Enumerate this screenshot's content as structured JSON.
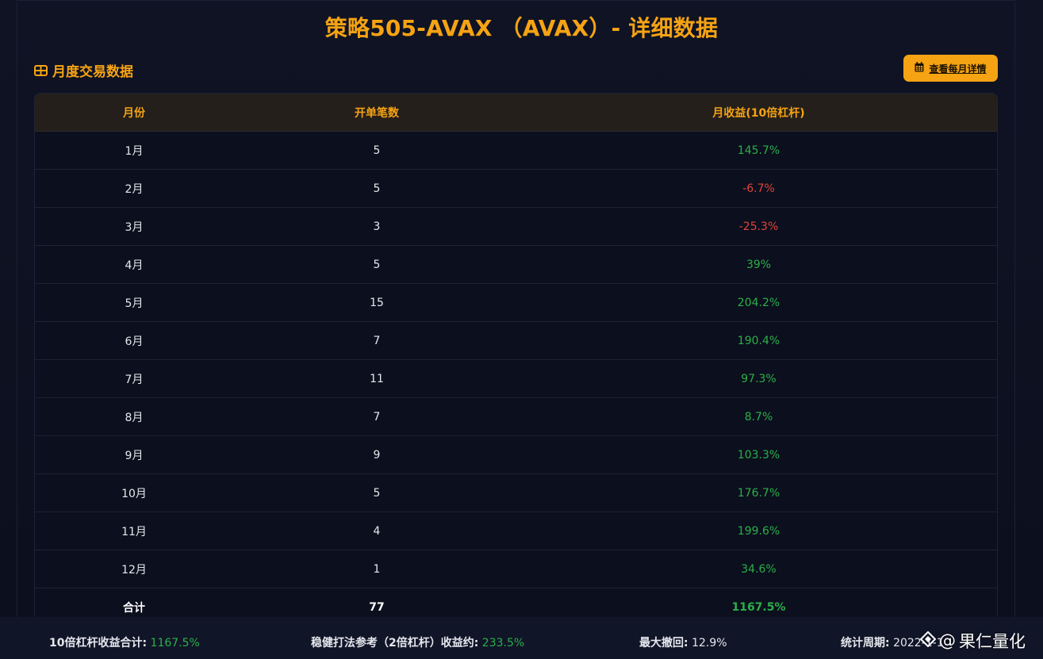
{
  "title": "策略505-AVAX （AVAX）- 详细数据",
  "section": {
    "icon": "table-icon",
    "title": "月度交易数据"
  },
  "detail_button": {
    "icon": "calendar-icon",
    "label": "查看每月详情"
  },
  "table": {
    "headers": [
      "月份",
      "开单笔数",
      "月收益(10倍杠杆)"
    ],
    "rows": [
      {
        "month": "1月",
        "trades": "5",
        "return": "145.7%",
        "status": "positive"
      },
      {
        "month": "2月",
        "trades": "5",
        "return": "-6.7%",
        "status": "negative"
      },
      {
        "month": "3月",
        "trades": "3",
        "return": "-25.3%",
        "status": "negative"
      },
      {
        "month": "4月",
        "trades": "5",
        "return": "39%",
        "status": "positive"
      },
      {
        "month": "5月",
        "trades": "15",
        "return": "204.2%",
        "status": "positive"
      },
      {
        "month": "6月",
        "trades": "7",
        "return": "190.4%",
        "status": "positive"
      },
      {
        "month": "7月",
        "trades": "11",
        "return": "97.3%",
        "status": "positive"
      },
      {
        "month": "8月",
        "trades": "7",
        "return": "8.7%",
        "status": "positive"
      },
      {
        "month": "9月",
        "trades": "9",
        "return": "103.3%",
        "status": "positive"
      },
      {
        "month": "10月",
        "trades": "5",
        "return": "176.7%",
        "status": "positive"
      },
      {
        "month": "11月",
        "trades": "4",
        "return": "199.6%",
        "status": "positive"
      },
      {
        "month": "12月",
        "trades": "1",
        "return": "34.6%",
        "status": "positive"
      }
    ],
    "total": {
      "month": "合计",
      "trades": "77",
      "return": "1167.5%"
    }
  },
  "summary": {
    "leverage_total_label": "10倍杠杆收益合计:",
    "leverage_total_value": "1167.5%",
    "steady_label": "稳健打法参考（2倍杠杆）收益约:",
    "steady_value": "233.5%",
    "max_drawdown_label": "最大撤回:",
    "max_drawdown_value": "12.9%",
    "period_label": "统计周期:",
    "period_value": "2022-1-1"
  },
  "watermark": {
    "prefix": "@",
    "text": "果仁量化"
  },
  "colors": {
    "accent": "#f6a313",
    "positive": "#29b04a",
    "negative": "#e0443a",
    "background": "#0e1120"
  }
}
